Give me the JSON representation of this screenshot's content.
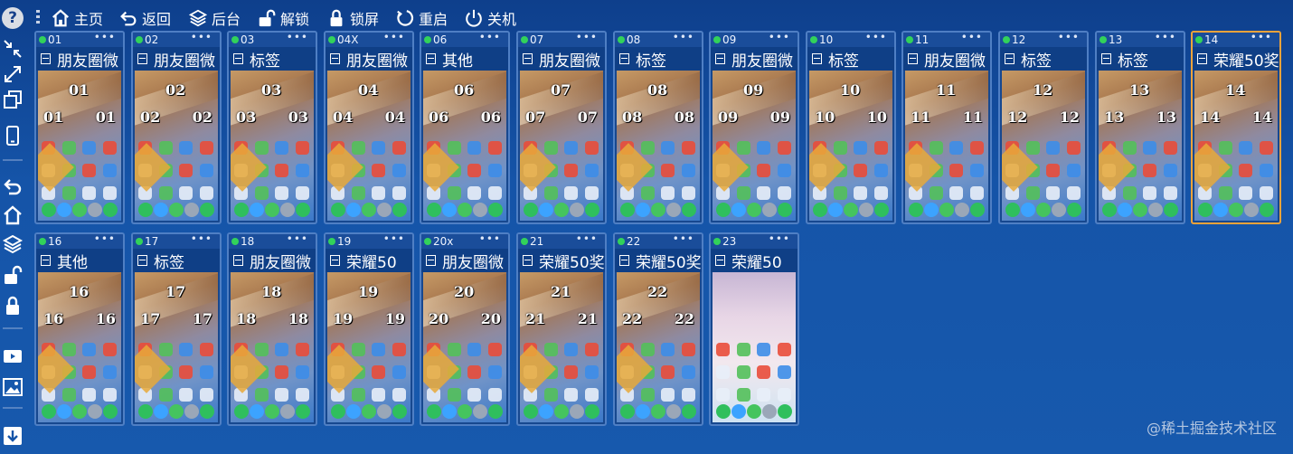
{
  "toolbar": {
    "help": "?",
    "buttons": [
      {
        "icon": "home-icon",
        "label": "主页"
      },
      {
        "icon": "back-icon",
        "label": "返回"
      },
      {
        "icon": "layers-icon",
        "label": "后台"
      },
      {
        "icon": "unlock-icon",
        "label": "解锁"
      },
      {
        "icon": "lock-icon",
        "label": "锁屏"
      },
      {
        "icon": "restart-icon",
        "label": "重启"
      },
      {
        "icon": "power-icon",
        "label": "关机"
      }
    ]
  },
  "sidebar": {
    "icons": [
      "shrink-icon",
      "expand-icon",
      "copy-icon",
      "phone-icon",
      "back-icon",
      "home-icon",
      "layers-icon",
      "unlock-icon",
      "lock-icon",
      "video-icon",
      "image-icon",
      "download-icon"
    ]
  },
  "devices": [
    {
      "id": "01",
      "label": "朋友圈微",
      "wm": "01"
    },
    {
      "id": "02",
      "label": "朋友圈微",
      "wm": "02"
    },
    {
      "id": "03",
      "label": "标签",
      "wm": "03"
    },
    {
      "id": "04X",
      "label": "朋友圈微",
      "wm": "04"
    },
    {
      "id": "06",
      "label": "其他",
      "wm": "06"
    },
    {
      "id": "07",
      "label": "朋友圈微",
      "wm": "07"
    },
    {
      "id": "08",
      "label": "标签",
      "wm": "08"
    },
    {
      "id": "09",
      "label": "朋友圈微",
      "wm": "09"
    },
    {
      "id": "10",
      "label": "标签",
      "wm": "10"
    },
    {
      "id": "11",
      "label": "朋友圈微",
      "wm": "11"
    },
    {
      "id": "12",
      "label": "标签",
      "wm": "12"
    },
    {
      "id": "13",
      "label": "标签",
      "wm": "13"
    },
    {
      "id": "14",
      "label": "荣耀50奖",
      "wm": "14",
      "selected": true
    },
    {
      "id": "16",
      "label": "其他",
      "wm": "16"
    },
    {
      "id": "17",
      "label": "标签",
      "wm": "17"
    },
    {
      "id": "18",
      "label": "朋友圈微",
      "wm": "18"
    },
    {
      "id": "19",
      "label": "荣耀50",
      "wm": "19"
    },
    {
      "id": "20x",
      "label": "朋友圈微",
      "wm": "20"
    },
    {
      "id": "21",
      "label": "荣耀50奖",
      "wm": "21"
    },
    {
      "id": "22",
      "label": "荣耀50奖",
      "wm": "22"
    },
    {
      "id": "23",
      "label": "荣耀50",
      "wm": "",
      "light": true
    }
  ],
  "more_glyph": "•••",
  "credit": "@稀土掘金技术社区",
  "colors": {
    "background": "#1554a8",
    "tile_border": "#4f7fc4",
    "selected_border": "#f0a33a",
    "online_dot": "#32d25a"
  }
}
